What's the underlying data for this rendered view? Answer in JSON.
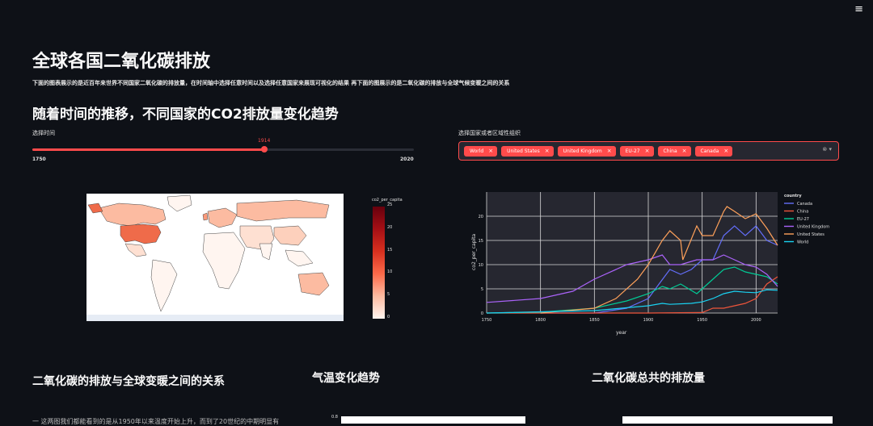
{
  "header": {
    "menu_icon": "hamburger-icon",
    "menu_symbol": "≡"
  },
  "page": {
    "title": "全球各国二氧化碳排放",
    "subtitle": "下面的图表展示的是近百年来世界不同国家二氧化碳的排放量，在时间轴中选择任意时间以及选择任意国家来展现可视化的结果 再下面的图展示的是二氧化碳的排放与全球气候变暖之间的关系"
  },
  "section1": {
    "heading": "随着时间的推移，不同国家的CO2排放量变化趋势",
    "slider": {
      "label": "选择时间",
      "value": 1914,
      "min": 1750,
      "max": 2020
    },
    "multiselect": {
      "label": "选择国家或者区域性组织",
      "selected": [
        "World",
        "United States",
        "United Kingdom",
        "EU-27",
        "China",
        "Canada"
      ],
      "remove_symbol": "×",
      "control_symbols": "⊗ ▾"
    }
  },
  "map": {
    "colorbar_title": "co2_per_capita",
    "colorbar_ticks": [
      "25",
      "20",
      "15",
      "10",
      "5",
      "0"
    ]
  },
  "chart_data": {
    "type": "line",
    "xlabel": "year",
    "ylabel": "co2_per_capita",
    "xlim": [
      1750,
      2020
    ],
    "ylim": [
      0,
      25
    ],
    "x_ticks": [
      1750,
      1800,
      1850,
      1900,
      1950,
      2000
    ],
    "y_ticks": [
      0,
      5,
      10,
      15,
      20
    ],
    "legend_title": "country",
    "legend_position": "top-right",
    "grid": true,
    "colors": {
      "Canada": "#636efa",
      "China": "#ef553b",
      "EU-27": "#00cc96",
      "United Kingdom": "#ab63fa",
      "United States": "#ffa15a",
      "World": "#19d3f3"
    },
    "series": [
      {
        "name": "Canada",
        "x": [
          1800,
          1850,
          1880,
          1900,
          1910,
          1920,
          1930,
          1940,
          1950,
          1960,
          1970,
          1980,
          1990,
          2000,
          2010,
          2020
        ],
        "values": [
          0,
          0,
          1,
          3,
          6,
          9,
          8,
          9,
          11,
          11,
          16,
          18,
          16,
          18,
          15,
          14
        ]
      },
      {
        "name": "China",
        "x": [
          1750,
          1900,
          1950,
          1960,
          1970,
          1980,
          1990,
          2000,
          2010,
          2020
        ],
        "values": [
          0,
          0,
          0.1,
          1,
          1,
          1.5,
          2,
          3,
          6,
          7.5
        ]
      },
      {
        "name": "EU-27",
        "x": [
          1750,
          1800,
          1850,
          1880,
          1900,
          1913,
          1920,
          1930,
          1945,
          1950,
          1960,
          1970,
          1980,
          1990,
          2000,
          2010,
          2020
        ],
        "values": [
          0,
          0.2,
          1,
          2.5,
          4,
          5.5,
          5,
          6,
          4,
          5,
          7,
          9,
          9.5,
          8.5,
          8,
          7.5,
          6
        ]
      },
      {
        "name": "United Kingdom",
        "x": [
          1750,
          1800,
          1830,
          1850,
          1880,
          1900,
          1913,
          1920,
          1930,
          1945,
          1950,
          1960,
          1970,
          1980,
          1990,
          2000,
          2010,
          2020
        ],
        "values": [
          2.2,
          3,
          4.5,
          7,
          10,
          11,
          12,
          10,
          10,
          11,
          11,
          11,
          12,
          11,
          10,
          9.5,
          8,
          5.5
        ]
      },
      {
        "name": "United States",
        "x": [
          1800,
          1850,
          1870,
          1890,
          1900,
          1913,
          1920,
          1930,
          1932,
          1945,
          1950,
          1960,
          1970,
          1973,
          1980,
          1990,
          2000,
          2010,
          2020
        ],
        "values": [
          0,
          1,
          3,
          7,
          10,
          15,
          17,
          15,
          11,
          18,
          16,
          16,
          21,
          22,
          21,
          19.5,
          20.5,
          17.5,
          14
        ]
      },
      {
        "name": "World",
        "x": [
          1750,
          1850,
          1900,
          1913,
          1920,
          1940,
          1950,
          1960,
          1970,
          1980,
          1990,
          2000,
          2010,
          2020
        ],
        "values": [
          0,
          0.5,
          1.5,
          2,
          1.8,
          2,
          2.3,
          3,
          4,
          4.5,
          4.3,
          4.2,
          4.8,
          4.7
        ]
      }
    ]
  },
  "section2": {
    "heading": "二氧化碳的排放与全球变暖之间的关系",
    "temp_title": "气温变化趋势",
    "total_title": "二氧化碳总共的排放量",
    "paragraph_fragment": "一 这两图我们都能看到的是从1950年以来温度开始上升，而到了20世纪的中期明显有",
    "temp_tick": "0.8"
  }
}
